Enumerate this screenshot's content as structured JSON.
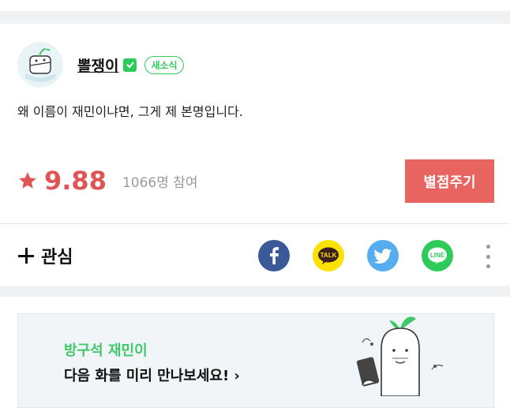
{
  "author": {
    "name": "뽈쟁이",
    "badge": "새소식"
  },
  "description": "왜 이름이 재민이냐면, 그게 제 본명입니다.",
  "rating": {
    "score": "9.88",
    "participants": "1066명 참여",
    "button_label": "별점주기"
  },
  "interest": {
    "label": "관심"
  },
  "share": [
    {
      "name": "facebook",
      "color": "#3b5998",
      "glyph": "f"
    },
    {
      "name": "kakaotalk",
      "color": "#fae100",
      "glyph": "TALK"
    },
    {
      "name": "twitter",
      "color": "#55acee",
      "glyph": ""
    },
    {
      "name": "line",
      "color": "#2fcb5a",
      "glyph": "LINE"
    }
  ],
  "banner": {
    "title": "방구석 재민이",
    "subtitle": "다음 화를 미리 만나보세요! ›"
  },
  "colors": {
    "accent_red": "#e05454",
    "button_red": "#e86461",
    "brand_green": "#2fcb5a"
  }
}
